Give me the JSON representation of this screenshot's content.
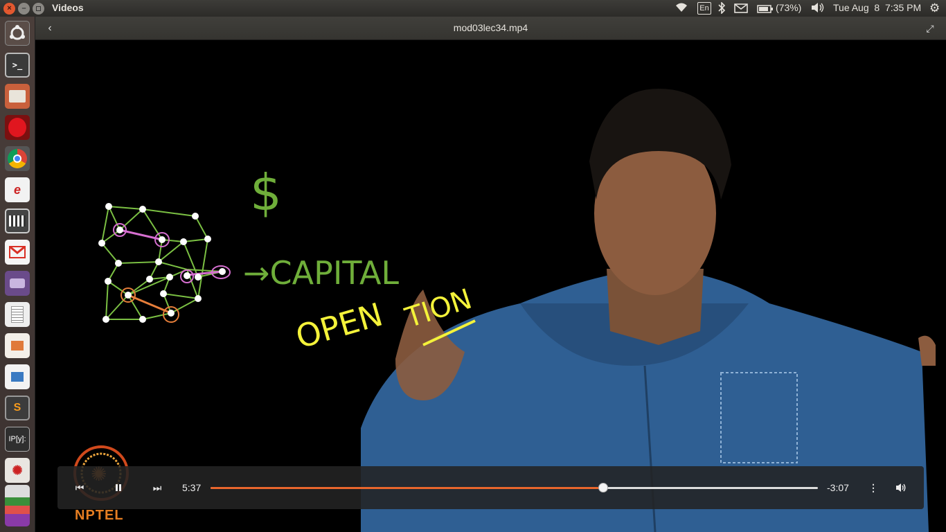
{
  "window": {
    "app_title": "Videos",
    "close_glyph": "×",
    "min_glyph": "–"
  },
  "panel": {
    "keyboard_layout": "En",
    "battery": "(73%)",
    "datetime": "Tue Aug  8  7:35 PM"
  },
  "launcher": {
    "items": [
      "dash",
      "terminal",
      "files",
      "opera",
      "chrome",
      "text-editor",
      "video-editor",
      "gmail",
      "screen-recorder",
      "gedit",
      "impress",
      "writer",
      "sublime-text",
      "ipython",
      "settings",
      "misc"
    ],
    "ipython_label": "IP[y]:",
    "sublime_label": "S"
  },
  "header": {
    "file_title": "mod03lec34.mp4"
  },
  "video_content": {
    "board_label_1": "→CAPITAL",
    "board_label_2": "OPEN",
    "board_label_3": "TION",
    "dollar": "$",
    "watermark": "NPTEL"
  },
  "controls": {
    "time_elapsed": "5:37",
    "time_remaining": "-3:07",
    "progress_fraction": 0.646
  }
}
